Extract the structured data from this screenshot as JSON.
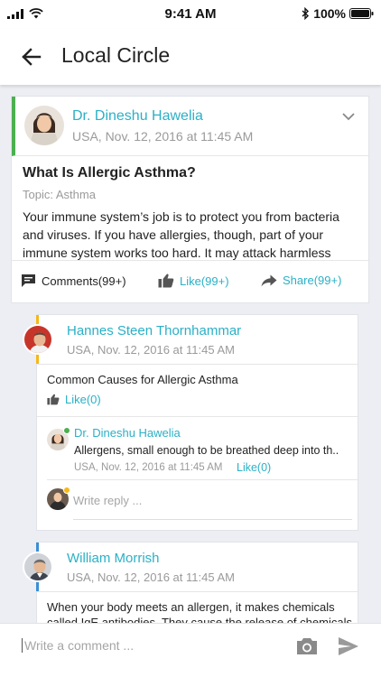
{
  "status_bar": {
    "time": "9:41 AM",
    "battery": "100%"
  },
  "header": {
    "title": "Local Circle"
  },
  "post": {
    "author": "Dr. Dineshu Hawelia",
    "meta": "USA, Nov. 12, 2016 at 11:45 AM",
    "title": "What Is Allergic Asthma?",
    "topic": "Topic: Asthma",
    "body_lines": [
      "Your immune system’s job is to protect you from bacteria",
      "and viruses. If you have allergies, though, part of your",
      "immune system works too hard. It may attack harmless"
    ],
    "actions": {
      "comments": "Comments(99+)",
      "like": "Like(99+)",
      "share": "Share(99+)"
    },
    "accent_color": "#4caf50"
  },
  "comments": [
    {
      "author": "Hannes Steen Thornhammar",
      "meta": "USA, Nov. 12, 2016 at 11:45 AM",
      "text": "Common Causes for Allergic Asthma",
      "like": "Like(0)",
      "accent_color": "#f5b81a",
      "reply": {
        "author": "Dr. Dineshu Hawelia",
        "text": "Allergens, small enough to be breathed deep into th..",
        "meta": "USA, Nov. 12, 2016 at 11:45 AM",
        "like": "Like(0)",
        "status_color": "#4caf50"
      },
      "write_reply_placeholder": "Write reply ..."
    },
    {
      "author": "William Morrish",
      "meta": "USA, Nov. 12, 2016 at 11:45 AM",
      "text_lines": [
        "When your body meets an allergen, it makes chemicals",
        "called IgE antibodies. They cause the release of chemicals"
      ],
      "accent_color": "#3a8fd6"
    }
  ],
  "comment_bar": {
    "placeholder": "Write a comment ..."
  },
  "colors": {
    "link": "#2bb0c6",
    "muted": "#9a9a9a",
    "background": "#eceef4"
  }
}
